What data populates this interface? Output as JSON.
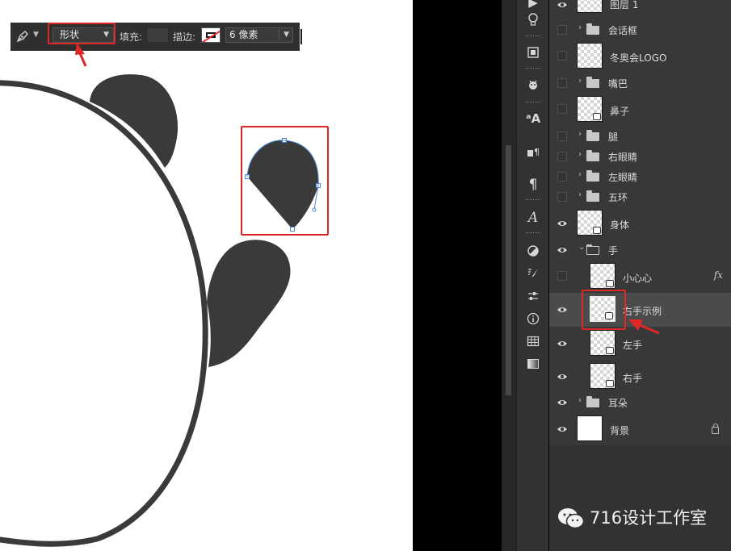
{
  "options_bar": {
    "tool_mode": "形状",
    "fill_label": "填充:",
    "stroke_label": "描边:",
    "stroke_width": "6 像素"
  },
  "tools": [
    {
      "name": "lightbulb-icon"
    },
    {
      "name": "3d-cube-icon"
    },
    {
      "name": "puppet-icon"
    },
    {
      "name": "character-style-icon"
    },
    {
      "name": "paragraph-style-icon"
    },
    {
      "name": "paragraph-icon"
    },
    {
      "name": "glyphs-icon"
    },
    {
      "name": "adjustments-icon"
    },
    {
      "name": "brush-settings-icon"
    },
    {
      "name": "properties-icon"
    },
    {
      "name": "info-icon"
    },
    {
      "name": "table-icon"
    },
    {
      "name": "gradient-icon"
    }
  ],
  "layers": [
    {
      "name": "图层 1",
      "visible": true,
      "kind": "layer"
    },
    {
      "name": "会话框",
      "visible": false,
      "kind": "group"
    },
    {
      "name": "冬奥会LOGO",
      "visible": false,
      "kind": "layer"
    },
    {
      "name": "嘴巴",
      "visible": false,
      "kind": "group"
    },
    {
      "name": "鼻子",
      "visible": false,
      "kind": "shape"
    },
    {
      "name": "腿",
      "visible": false,
      "kind": "group"
    },
    {
      "name": "右眼睛",
      "visible": false,
      "kind": "group"
    },
    {
      "name": "左眼睛",
      "visible": false,
      "kind": "group"
    },
    {
      "name": "五环",
      "visible": false,
      "kind": "group"
    },
    {
      "name": "身体",
      "visible": true,
      "kind": "shape"
    },
    {
      "name": "手",
      "visible": true,
      "kind": "group-open"
    },
    {
      "name": "小心心",
      "visible": false,
      "kind": "shape",
      "effect": "fx"
    },
    {
      "name": "右手示例",
      "visible": true,
      "kind": "shape",
      "selected": true
    },
    {
      "name": "左手",
      "visible": true,
      "kind": "shape"
    },
    {
      "name": "右手",
      "visible": true,
      "kind": "shape"
    },
    {
      "name": "耳朵",
      "visible": true,
      "kind": "group"
    },
    {
      "name": "背景",
      "visible": true,
      "kind": "background",
      "locked": true
    }
  ],
  "watermark": "716设计工作室",
  "colors": {
    "shape_fill": "#3a3a3a",
    "highlight_red": "#e02727",
    "panel_bg": "#383838"
  }
}
